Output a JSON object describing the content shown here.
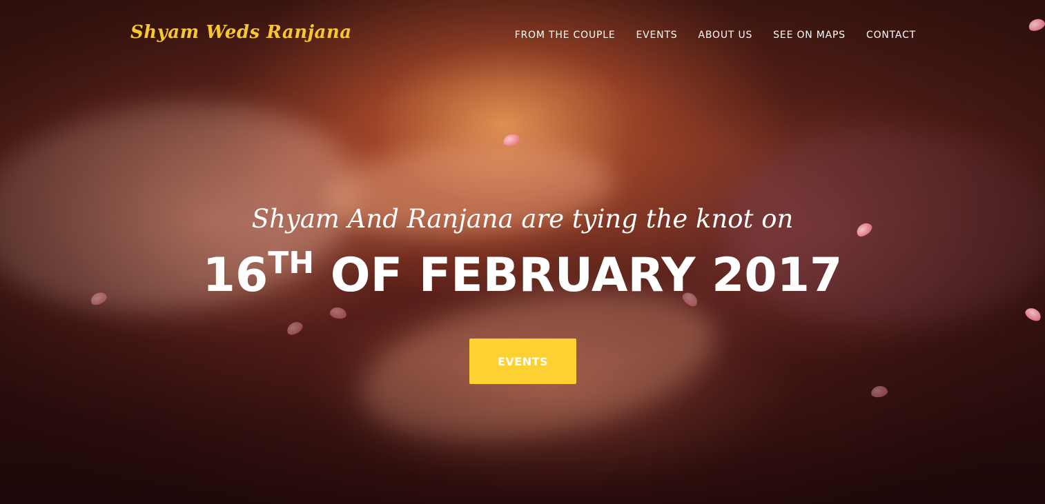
{
  "brand": {
    "text": "Shyam Weds Ranjana"
  },
  "nav": {
    "items": [
      {
        "label": "FROM THE COUPLE"
      },
      {
        "label": "EVENTS"
      },
      {
        "label": "ABOUT US"
      },
      {
        "label": "SEE ON MAPS"
      },
      {
        "label": "CONTACT"
      }
    ]
  },
  "hero": {
    "tagline": "Shyam And Ranjana are tying the knot on",
    "date_day": "16",
    "date_suffix": "TH",
    "date_rest": " OF FEBRUARY 2017",
    "cta_label": "EVENTS",
    "background_image": "bride-groom-hands-mehndi",
    "decoration": "falling-rose-petals"
  },
  "colors": {
    "accent": "#fdd131",
    "brand": "#f7c730",
    "text": "#ffffff"
  }
}
